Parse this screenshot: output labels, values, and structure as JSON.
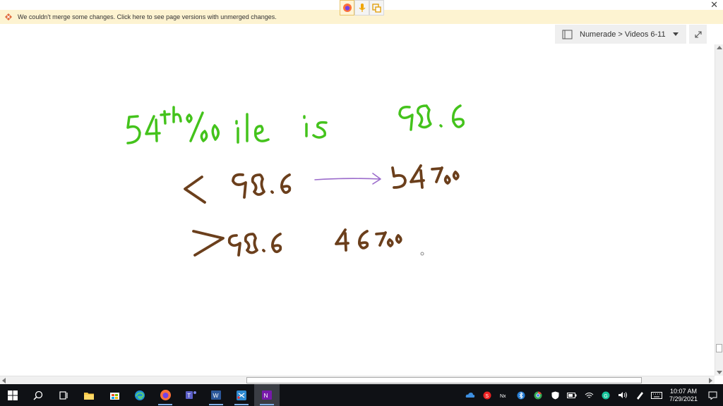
{
  "warning": {
    "text": "We couldn't merge some changes. Click here to see page versions with unmerged changes."
  },
  "notebook_selector": {
    "label": "Numerade > Videos 6-11"
  },
  "floating_toolbar": {
    "buttons": [
      "firefox-icon",
      "microphone-icon",
      "screen-clip-icon"
    ]
  },
  "ink": {
    "line1": {
      "text": "54th %ile is 98.6",
      "color": "#44c31c"
    },
    "line2": {
      "text": "< 98.6 → 54%",
      "color": "#6b3f1c",
      "arrow_color": "#9b6bcb"
    },
    "line3": {
      "text": "> 98.6 46%",
      "color": "#6b3f1c"
    }
  },
  "taskbar": {
    "apps": [
      "windows-start-icon",
      "search-icon",
      "task-view-icon",
      "file-explorer-icon",
      "store-icon",
      "edge-icon",
      "firefox-icon",
      "teams-icon",
      "word-icon",
      "snip-icon",
      "onenote-icon"
    ],
    "tray": [
      "onedrive-icon",
      "s-app-icon",
      "network-nx-icon",
      "bluetooth-icon",
      "chrome-icon",
      "defender-icon",
      "battery-icon",
      "wifi-icon",
      "grammarly-icon",
      "volume-icon",
      "pen-icon",
      "keyboard-icon"
    ],
    "time": "10:07 AM",
    "date": "7/29/2021"
  }
}
